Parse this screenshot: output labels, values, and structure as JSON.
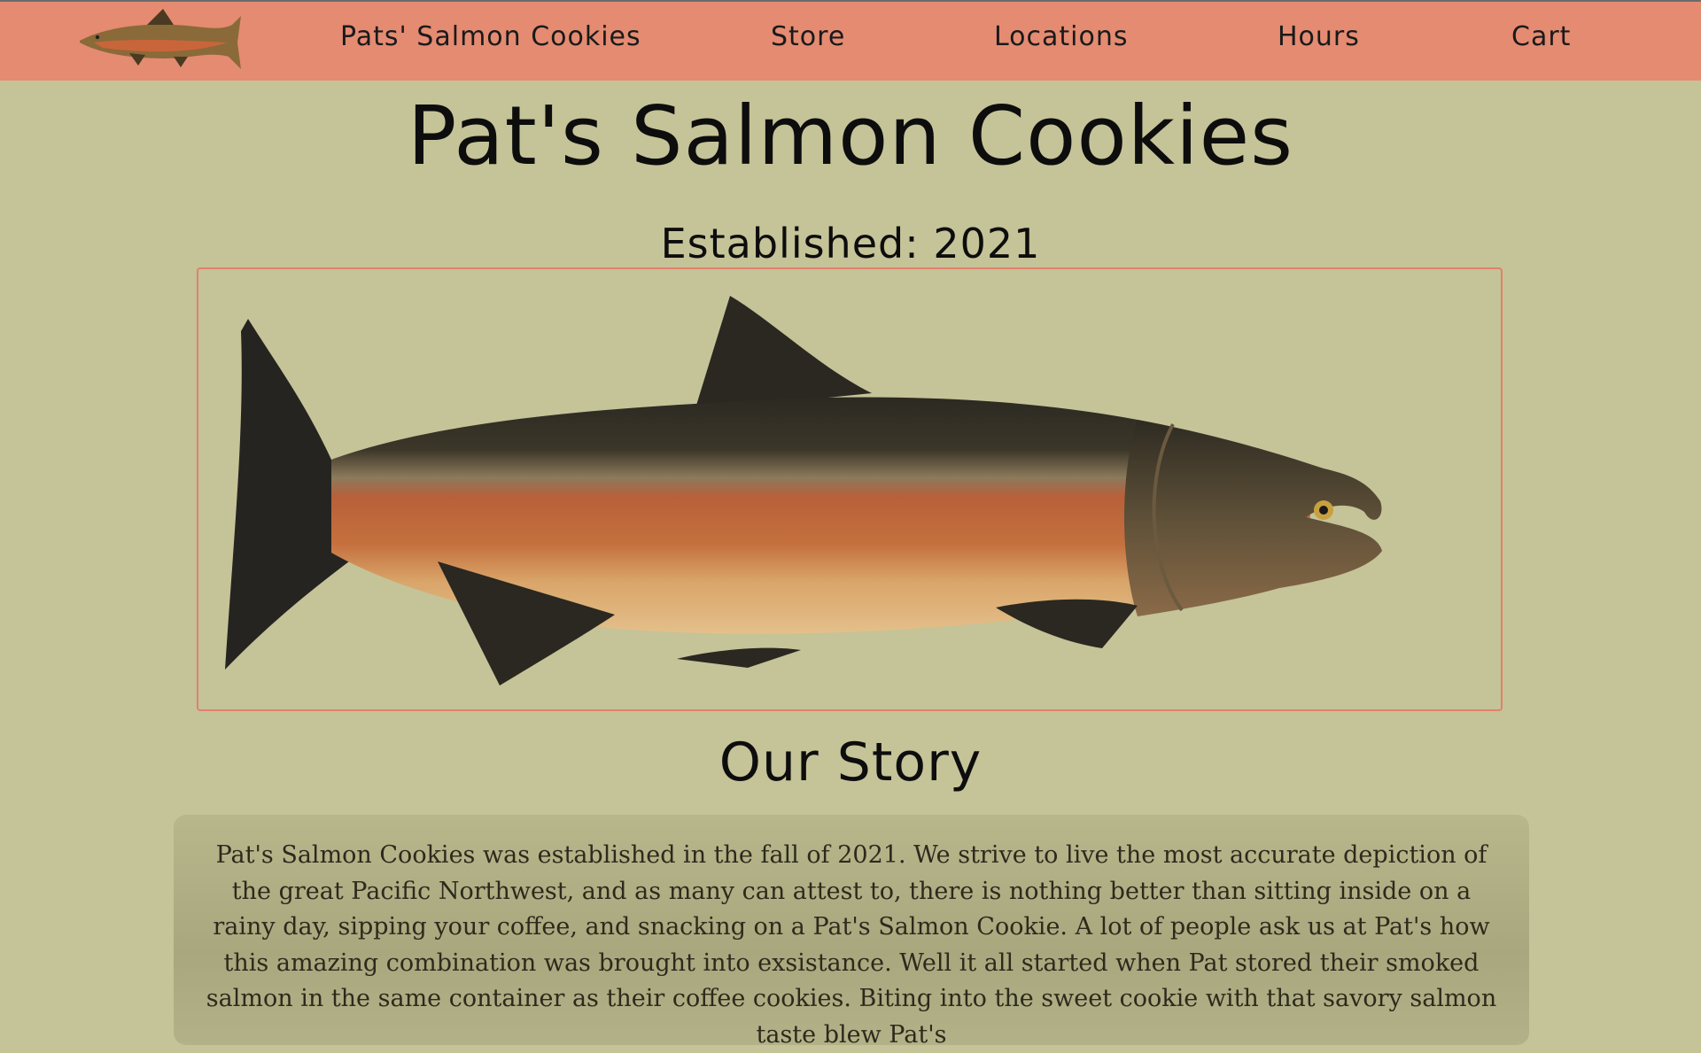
{
  "nav": {
    "logo_icon": "salmon-logo-icon",
    "items": [
      {
        "label": "Pats' Salmon Cookies"
      },
      {
        "label": "Store"
      },
      {
        "label": "Locations"
      },
      {
        "label": "Hours"
      },
      {
        "label": "Cart"
      }
    ]
  },
  "main": {
    "title": "Pat's Salmon Cookies",
    "established": "Established: 2021",
    "hero_image": "salmon-illustration",
    "story": {
      "heading": "Our Story",
      "text": "Pat's Salmon Cookies was established in the fall of 2021. We strive to live the most accurate depiction of the great Pacific Northwest, and as many can attest to, there is nothing better than sitting inside on a rainy day, sipping your coffee, and snacking on a Pat's Salmon Cookie. A lot of people ask us at Pat's how this amazing combination was brought into exsistance. Well it all started when Pat stored their smoked salmon in the same container as their coffee cookies. Biting into the sweet cookie with that savory salmon taste blew Pat's"
    }
  },
  "colors": {
    "background": "#c5c398",
    "nav_background": "#e48b72",
    "frame_border": "#e0826c",
    "story_box": "#aeac82"
  }
}
